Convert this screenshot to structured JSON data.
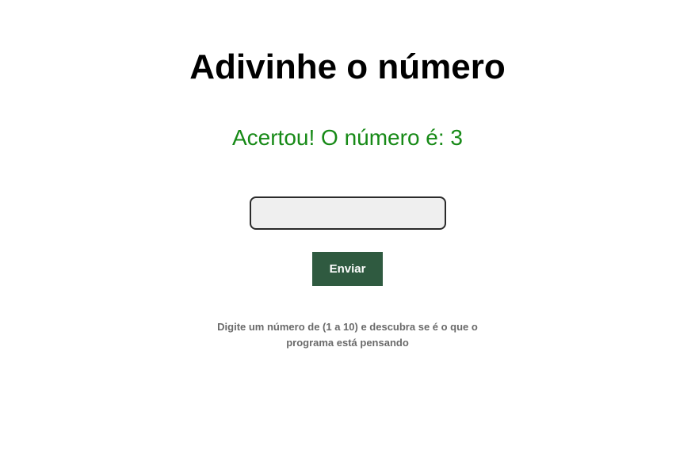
{
  "title": "Adivinhe o número",
  "result": "Acertou! O número é: 3",
  "input": {
    "value": ""
  },
  "button": {
    "label": "Enviar"
  },
  "instructions": "Digite um número de (1 a 10) e descubra se é o que o programa está pensando"
}
